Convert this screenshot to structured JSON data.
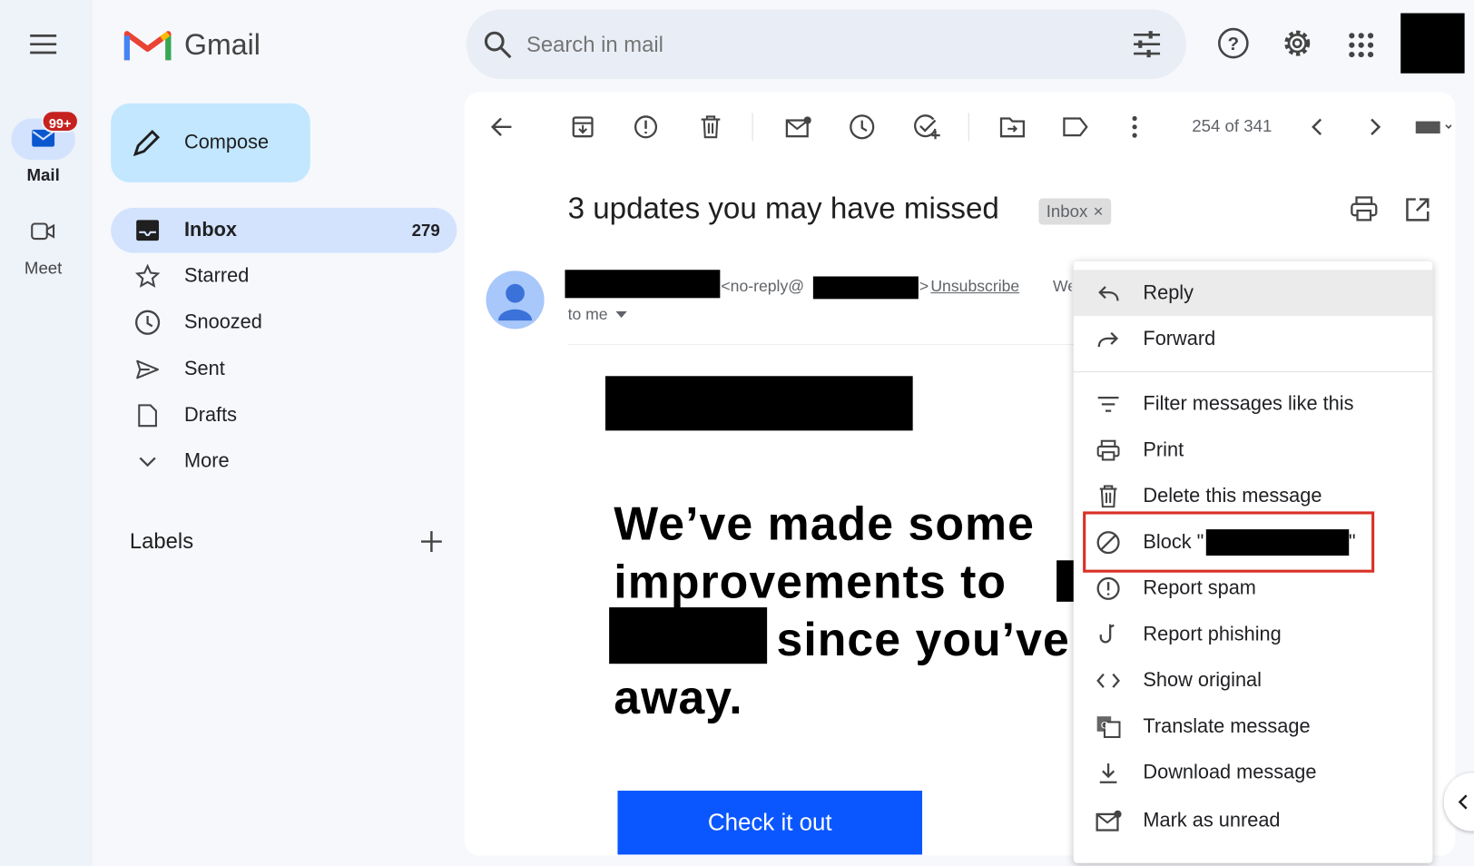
{
  "app": {
    "name": "Gmail"
  },
  "rail": {
    "mail_label": "Mail",
    "mail_badge": "99+",
    "meet_label": "Meet"
  },
  "compose_label": "Compose",
  "search": {
    "placeholder": "Search in mail"
  },
  "nav": [
    {
      "label": "Inbox",
      "count": "279",
      "icon": "inbox-icon"
    },
    {
      "label": "Starred",
      "icon": "star-icon"
    },
    {
      "label": "Snoozed",
      "icon": "clock-icon"
    },
    {
      "label": "Sent",
      "icon": "send-icon"
    },
    {
      "label": "Drafts",
      "icon": "draft-icon"
    },
    {
      "label": "More",
      "icon": "chevron-down-icon"
    }
  ],
  "labels_heading": "Labels",
  "toolbar": {
    "pagination": "254 of 341"
  },
  "email": {
    "subject": "3 updates you may have missed",
    "label_chip": "Inbox",
    "sender_email_prefix": "<no-reply@",
    "sender_email_suffix": ">",
    "unsubscribe": "Unsubscribe",
    "recipient": "to me",
    "truncated": "We",
    "body_line1": "We’ve made some",
    "body_line2": "improvements to",
    "body_line3": "since you’ve",
    "body_line4": "away.",
    "cta": "Check it out",
    "cta_color": "#0b57ff"
  },
  "menu": {
    "items": [
      {
        "label": "Reply",
        "icon": "reply-icon"
      },
      {
        "label": "Forward",
        "icon": "forward-icon"
      },
      {
        "label": "Filter messages like this",
        "icon": "filter-icon"
      },
      {
        "label": "Print",
        "icon": "print-icon"
      },
      {
        "label": "Delete this message",
        "icon": "trash-icon"
      },
      {
        "label": "Block \"",
        "icon": "block-icon"
      },
      {
        "label": "Report spam",
        "icon": "report-spam-icon"
      },
      {
        "label": "Report phishing",
        "icon": "phishing-icon"
      },
      {
        "label": "Show original",
        "icon": "code-icon"
      },
      {
        "label": "Translate message",
        "icon": "translate-icon"
      },
      {
        "label": "Download message",
        "icon": "download-icon"
      },
      {
        "label": "Mark as unread",
        "icon": "mark-unread-icon"
      }
    ],
    "highlight_color": "#d93025"
  }
}
